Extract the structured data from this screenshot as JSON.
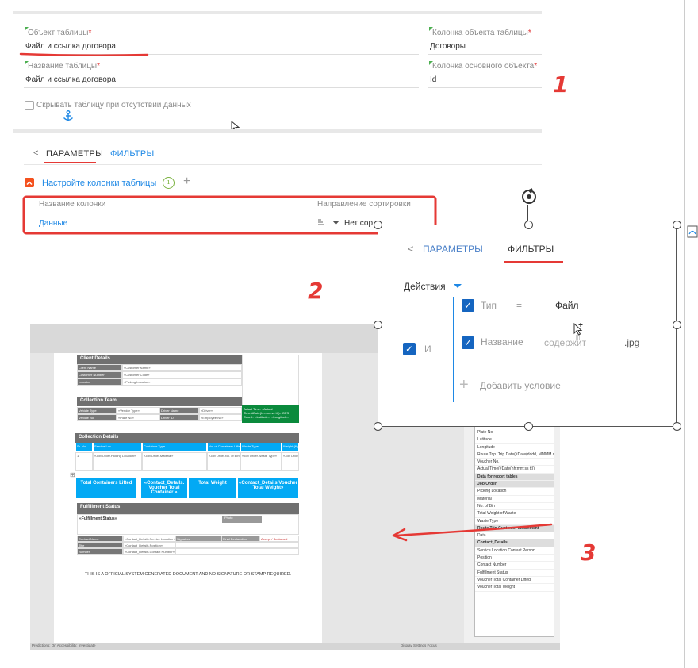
{
  "form": {
    "field1": {
      "label": "Объект таблицы",
      "req": "*",
      "value": "Файл и ссылка договора"
    },
    "field2": {
      "label": "Колонка объекта таблицы",
      "req": "*",
      "value": "Договоры"
    },
    "field3": {
      "label": "Название таблицы",
      "req": "*",
      "value": "Файл и ссылка договора"
    },
    "field4": {
      "label": "Колонка основного объекта",
      "req": "*",
      "value": "Id"
    },
    "hide_checkbox_label": "Скрывать таблицу при отсутствии данных"
  },
  "tabs": {
    "back": "<",
    "parameters": "ПАРАМЕТРЫ",
    "filters": "ФИЛЬТРЫ"
  },
  "columns_section": {
    "title": "Настройте колонки таблицы",
    "info": "i",
    "add": "+",
    "header_name": "Название колонки",
    "header_sort": "Направление сортировки",
    "row_name": "Данные",
    "row_sort": "Нет сортировки",
    "row_sort_visible": "Нет сор"
  },
  "markers": {
    "m1": "1",
    "m2": "2",
    "m3": "3"
  },
  "popup": {
    "tab_back": "<",
    "tab_parameters": "ПАРАМЕТРЫ",
    "tab_filters": "ФИЛЬТРЫ",
    "actions": "Действия",
    "group_label": "И",
    "conditions": [
      {
        "field": "Тип",
        "op": "=",
        "value": "Файл"
      },
      {
        "field": "Название",
        "op": "содержит",
        "value": ".jpg"
      }
    ],
    "add_condition": "Добавить условие",
    "check": "✓"
  },
  "document": {
    "client_details": "Client Details",
    "client_rows": [
      {
        "k": "Client Name",
        "v": "«Customer Name»"
      },
      {
        "k": "Customer Number",
        "v": "«Customer Code»"
      },
      {
        "k": "Location",
        "v": "«Picking Location»"
      }
    ],
    "collection_team": "Collection Team",
    "team_rows": [
      {
        "k1": "Vehicle Type",
        "v1": "«Vendor Type»",
        "k2": "Driver Name",
        "v2": "«Driver»"
      },
      {
        "k1": "Vehicle No.",
        "v1": "«Plate No»",
        "k2": "Driver ID",
        "v2": "«Employee No»"
      }
    ],
    "green_text": "Actual Time: «Actual Time(#Date(hh:mm:ss tt))» GPS Coord.: «Latitude», «Longitude»",
    "collection_details": "Collection Details",
    "cd_headers": [
      "Sr. No.",
      "Service Loc.",
      "Container Type",
      "No. of Containers Lifted",
      "Waste Type",
      "Weight (Kg)"
    ],
    "cd_row": [
      "1",
      "«Job Order.Picking Location»",
      "«Job Order.Material»",
      "«Job Order.No. of Bins»",
      "«Job Order.Waste Type»",
      "«Job Order.Total Weight of Waste»"
    ],
    "cyan": [
      "Total Containers Lifted",
      "«Contact_Details. Voucher Total Container »",
      "Total Weight",
      "«Contact_Details.Voucher Total Weight»"
    ],
    "fulfillment": "Fulfillment Status",
    "fulfillment_value": "«Fulfillment Status»",
    "photo": "Photo",
    "sign_rows": [
      {
        "k": "Contact Name",
        "v": "«Contact_Details.Service Location Contact»",
        "k2": "Signature",
        "k3": "Final Declaration",
        "v3": "Accept / Sustained"
      },
      {
        "k": "Title",
        "v": "«Contact_Details.Position»",
        "k2": "",
        "k3": "",
        "v3": ""
      },
      {
        "k": "Number",
        "v": "«Contact_Details.Contact Number»",
        "k2": "",
        "k3": "",
        "v3": ""
      }
    ],
    "footer": "THIS IS A OFFICIAL SYSTEM GENERATED DOCUMENT AND NO SIGNATURE OR STAMP REQUIRED.",
    "status_left": "Predictions: On     Accessibility: Investigate",
    "status_right": "Display Settings   Focus"
  },
  "field_list": [
    {
      "t": "Plate No",
      "h": false
    },
    {
      "t": "Latitude",
      "h": false
    },
    {
      "t": "Longitude",
      "h": false
    },
    {
      "t": "Route Trip. Trip Date(#Date(dddd, MMMM d, y…",
      "h": false
    },
    {
      "t": "Voucher No.",
      "h": false
    },
    {
      "t": "Actual Time(#Date(hh:mm:ss tt))",
      "h": false
    },
    {
      "t": "Data for report tables",
      "h": true
    },
    {
      "t": "Job Order",
      "h": true
    },
    {
      "t": "Picking Location",
      "h": false
    },
    {
      "t": "Material",
      "h": false
    },
    {
      "t": "No. of Bin",
      "h": false
    },
    {
      "t": "Total Weight of Waste",
      "h": false
    },
    {
      "t": "Waste Type",
      "h": false
    },
    {
      "t": "Route Trip Customer attachment",
      "h": true
    },
    {
      "t": "Data",
      "h": false
    },
    {
      "t": "Contact_Details",
      "h": true
    },
    {
      "t": "Service Location Contact Person",
      "h": false
    },
    {
      "t": "Position",
      "h": false
    },
    {
      "t": "Contact Number",
      "h": false
    },
    {
      "t": "Fulfillment Status",
      "h": false
    },
    {
      "t": "Voucher Total Container Lifted",
      "h": false
    },
    {
      "t": "Voucher Total Weight",
      "h": false
    }
  ]
}
